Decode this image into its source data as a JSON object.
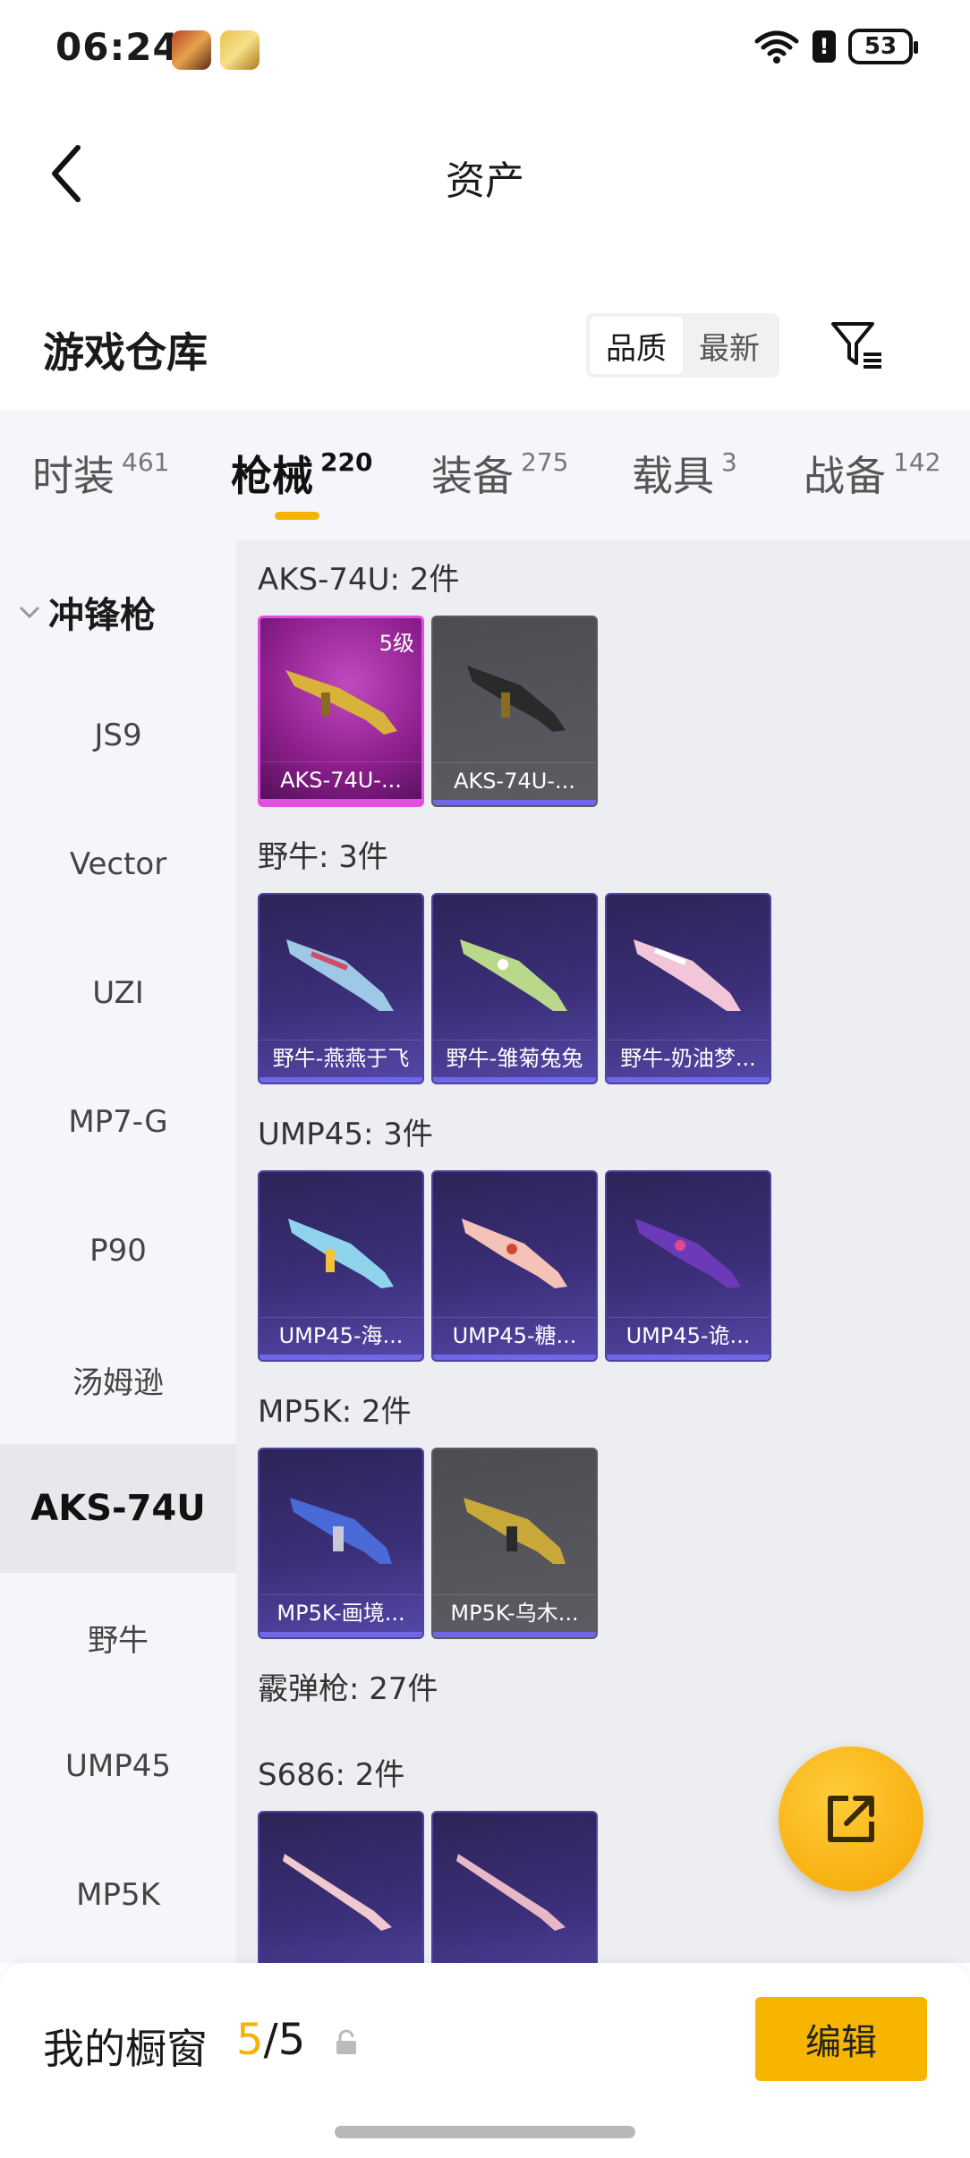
{
  "status": {
    "time": "06:24",
    "battery": "53",
    "alert": "!"
  },
  "nav": {
    "title": "资产"
  },
  "warehouse": {
    "title": "游戏仓库",
    "sort_quality": "品质",
    "sort_latest": "最新"
  },
  "tabs": [
    {
      "label": "时装",
      "count": "461"
    },
    {
      "label": "枪械",
      "count": "220"
    },
    {
      "label": "装备",
      "count": "275"
    },
    {
      "label": "载具",
      "count": "3"
    },
    {
      "label": "战备",
      "count": "142"
    }
  ],
  "sidebar": {
    "group": "冲锋枪",
    "items": [
      "JS9",
      "Vector",
      "UZI",
      "MP7-G",
      "P90",
      "汤姆逊",
      "AKS-74U",
      "野牛",
      "UMP45",
      "MP5K"
    ]
  },
  "sections": [
    {
      "title": "AKS-74U: 2件",
      "cards": [
        {
          "name": "AKS-74U-...",
          "level": "5级",
          "style": "pink"
        },
        {
          "name": "AKS-74U-...",
          "style": "grey"
        }
      ]
    },
    {
      "title": "野牛: 3件",
      "cards": [
        {
          "name": "野牛-燕燕于飞"
        },
        {
          "name": "野牛-雏菊兔兔"
        },
        {
          "name": "野牛-奶油梦..."
        }
      ]
    },
    {
      "title": "UMP45: 3件",
      "cards": [
        {
          "name": "UMP45-海..."
        },
        {
          "name": "UMP45-糖..."
        },
        {
          "name": "UMP45-诡..."
        }
      ]
    },
    {
      "title": "MP5K: 2件",
      "cards": [
        {
          "name": "MP5K-画境..."
        },
        {
          "name": "MP5K-乌木...",
          "style": "grey"
        }
      ]
    },
    {
      "title": "霰弹枪: 27件"
    },
    {
      "title": "S686: 2件"
    }
  ],
  "showcase": {
    "label": "我的橱窗",
    "current": "5",
    "total": "/5",
    "edit": "编辑"
  },
  "colors": {
    "accent": "#f5b301",
    "card_purple": "#3b2f79",
    "card_pink": "#8e1f8e",
    "card_grey": "#5c5c62"
  }
}
